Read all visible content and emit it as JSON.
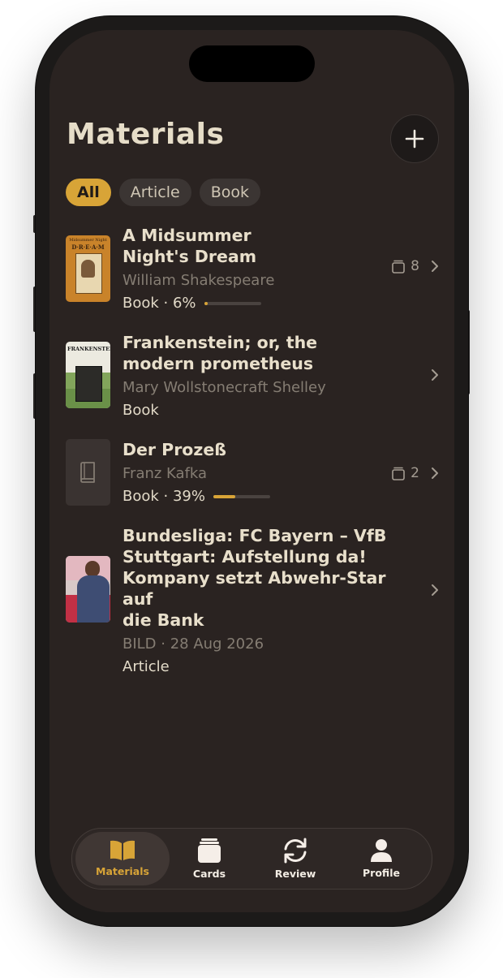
{
  "header": {
    "title": "Materials"
  },
  "filters": [
    {
      "label": "All",
      "active": true
    },
    {
      "label": "Article",
      "active": false
    },
    {
      "label": "Book",
      "active": false
    }
  ],
  "materials": [
    {
      "title_line1": "A Midsummer",
      "title_line2": "Night's Dream",
      "author": "William Shakespeare",
      "type": "Book · 6%",
      "progress": 0.06,
      "cards": "8"
    },
    {
      "title_line1": "Frankenstein; or, the",
      "title_line2": "modern prometheus",
      "author": "Mary Wollstonecraft Shelley",
      "type": "Book"
    },
    {
      "title_line1": "Der Prozeß",
      "author": "Franz Kafka",
      "type": "Book · 39%",
      "progress": 0.39,
      "cards": "2"
    },
    {
      "title_line1": "Bundesliga: FC Bayern – VfB",
      "title_line2": "Stuttgart: Aufstellung da!",
      "title_line3": "Kompany setzt Abwehr-Star auf",
      "title_line4": "die Bank",
      "author": "BILD · 28 Aug 2026",
      "type": "Article"
    }
  ],
  "covers": {
    "midsummer": {
      "line1": "Midsummer Night",
      "line2": "D·R·E·A·M"
    },
    "frankenstein": {
      "line1": "FRANKENSTEIN"
    }
  },
  "tabbar": {
    "tabs": [
      {
        "label": "Materials",
        "active": true
      },
      {
        "label": "Cards"
      },
      {
        "label": "Review"
      },
      {
        "label": "Profile"
      }
    ]
  },
  "colors": {
    "accent": "#d8a437",
    "background": "#2a2321",
    "text": "#e8dfcb"
  }
}
